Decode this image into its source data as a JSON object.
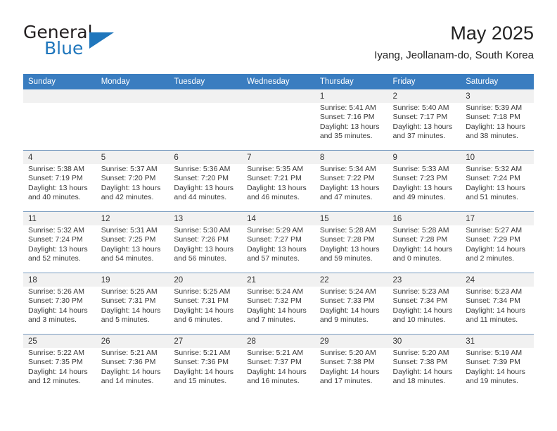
{
  "brand": {
    "word_one": "General",
    "word_two": "Blue",
    "logo_icon": "blue-triangle-logo"
  },
  "header": {
    "title": "May 2025",
    "subtitle": "Iyang, Jeollanam-do, South Korea"
  },
  "colors": {
    "header_blue": "#3a7dc0",
    "brand_blue": "#1f76bc",
    "daynum_band": "#f1f1f1",
    "row_divider": "#7a9cc0",
    "text": "#3a3a3a"
  },
  "weekday_headers": [
    "Sunday",
    "Monday",
    "Tuesday",
    "Wednesday",
    "Thursday",
    "Friday",
    "Saturday"
  ],
  "weeks": [
    [
      {
        "day": "",
        "lines": []
      },
      {
        "day": "",
        "lines": []
      },
      {
        "day": "",
        "lines": []
      },
      {
        "day": "",
        "lines": []
      },
      {
        "day": "1",
        "lines": [
          "Sunrise: 5:41 AM",
          "Sunset: 7:16 PM",
          "Daylight: 13 hours",
          "and 35 minutes."
        ]
      },
      {
        "day": "2",
        "lines": [
          "Sunrise: 5:40 AM",
          "Sunset: 7:17 PM",
          "Daylight: 13 hours",
          "and 37 minutes."
        ]
      },
      {
        "day": "3",
        "lines": [
          "Sunrise: 5:39 AM",
          "Sunset: 7:18 PM",
          "Daylight: 13 hours",
          "and 38 minutes."
        ]
      }
    ],
    [
      {
        "day": "4",
        "lines": [
          "Sunrise: 5:38 AM",
          "Sunset: 7:19 PM",
          "Daylight: 13 hours",
          "and 40 minutes."
        ]
      },
      {
        "day": "5",
        "lines": [
          "Sunrise: 5:37 AM",
          "Sunset: 7:20 PM",
          "Daylight: 13 hours",
          "and 42 minutes."
        ]
      },
      {
        "day": "6",
        "lines": [
          "Sunrise: 5:36 AM",
          "Sunset: 7:20 PM",
          "Daylight: 13 hours",
          "and 44 minutes."
        ]
      },
      {
        "day": "7",
        "lines": [
          "Sunrise: 5:35 AM",
          "Sunset: 7:21 PM",
          "Daylight: 13 hours",
          "and 46 minutes."
        ]
      },
      {
        "day": "8",
        "lines": [
          "Sunrise: 5:34 AM",
          "Sunset: 7:22 PM",
          "Daylight: 13 hours",
          "and 47 minutes."
        ]
      },
      {
        "day": "9",
        "lines": [
          "Sunrise: 5:33 AM",
          "Sunset: 7:23 PM",
          "Daylight: 13 hours",
          "and 49 minutes."
        ]
      },
      {
        "day": "10",
        "lines": [
          "Sunrise: 5:32 AM",
          "Sunset: 7:24 PM",
          "Daylight: 13 hours",
          "and 51 minutes."
        ]
      }
    ],
    [
      {
        "day": "11",
        "lines": [
          "Sunrise: 5:32 AM",
          "Sunset: 7:24 PM",
          "Daylight: 13 hours",
          "and 52 minutes."
        ]
      },
      {
        "day": "12",
        "lines": [
          "Sunrise: 5:31 AM",
          "Sunset: 7:25 PM",
          "Daylight: 13 hours",
          "and 54 minutes."
        ]
      },
      {
        "day": "13",
        "lines": [
          "Sunrise: 5:30 AM",
          "Sunset: 7:26 PM",
          "Daylight: 13 hours",
          "and 56 minutes."
        ]
      },
      {
        "day": "14",
        "lines": [
          "Sunrise: 5:29 AM",
          "Sunset: 7:27 PM",
          "Daylight: 13 hours",
          "and 57 minutes."
        ]
      },
      {
        "day": "15",
        "lines": [
          "Sunrise: 5:28 AM",
          "Sunset: 7:28 PM",
          "Daylight: 13 hours",
          "and 59 minutes."
        ]
      },
      {
        "day": "16",
        "lines": [
          "Sunrise: 5:28 AM",
          "Sunset: 7:28 PM",
          "Daylight: 14 hours",
          "and 0 minutes."
        ]
      },
      {
        "day": "17",
        "lines": [
          "Sunrise: 5:27 AM",
          "Sunset: 7:29 PM",
          "Daylight: 14 hours",
          "and 2 minutes."
        ]
      }
    ],
    [
      {
        "day": "18",
        "lines": [
          "Sunrise: 5:26 AM",
          "Sunset: 7:30 PM",
          "Daylight: 14 hours",
          "and 3 minutes."
        ]
      },
      {
        "day": "19",
        "lines": [
          "Sunrise: 5:25 AM",
          "Sunset: 7:31 PM",
          "Daylight: 14 hours",
          "and 5 minutes."
        ]
      },
      {
        "day": "20",
        "lines": [
          "Sunrise: 5:25 AM",
          "Sunset: 7:31 PM",
          "Daylight: 14 hours",
          "and 6 minutes."
        ]
      },
      {
        "day": "21",
        "lines": [
          "Sunrise: 5:24 AM",
          "Sunset: 7:32 PM",
          "Daylight: 14 hours",
          "and 7 minutes."
        ]
      },
      {
        "day": "22",
        "lines": [
          "Sunrise: 5:24 AM",
          "Sunset: 7:33 PM",
          "Daylight: 14 hours",
          "and 9 minutes."
        ]
      },
      {
        "day": "23",
        "lines": [
          "Sunrise: 5:23 AM",
          "Sunset: 7:34 PM",
          "Daylight: 14 hours",
          "and 10 minutes."
        ]
      },
      {
        "day": "24",
        "lines": [
          "Sunrise: 5:23 AM",
          "Sunset: 7:34 PM",
          "Daylight: 14 hours",
          "and 11 minutes."
        ]
      }
    ],
    [
      {
        "day": "25",
        "lines": [
          "Sunrise: 5:22 AM",
          "Sunset: 7:35 PM",
          "Daylight: 14 hours",
          "and 12 minutes."
        ]
      },
      {
        "day": "26",
        "lines": [
          "Sunrise: 5:21 AM",
          "Sunset: 7:36 PM",
          "Daylight: 14 hours",
          "and 14 minutes."
        ]
      },
      {
        "day": "27",
        "lines": [
          "Sunrise: 5:21 AM",
          "Sunset: 7:36 PM",
          "Daylight: 14 hours",
          "and 15 minutes."
        ]
      },
      {
        "day": "28",
        "lines": [
          "Sunrise: 5:21 AM",
          "Sunset: 7:37 PM",
          "Daylight: 14 hours",
          "and 16 minutes."
        ]
      },
      {
        "day": "29",
        "lines": [
          "Sunrise: 5:20 AM",
          "Sunset: 7:38 PM",
          "Daylight: 14 hours",
          "and 17 minutes."
        ]
      },
      {
        "day": "30",
        "lines": [
          "Sunrise: 5:20 AM",
          "Sunset: 7:38 PM",
          "Daylight: 14 hours",
          "and 18 minutes."
        ]
      },
      {
        "day": "31",
        "lines": [
          "Sunrise: 5:19 AM",
          "Sunset: 7:39 PM",
          "Daylight: 14 hours",
          "and 19 minutes."
        ]
      }
    ]
  ]
}
